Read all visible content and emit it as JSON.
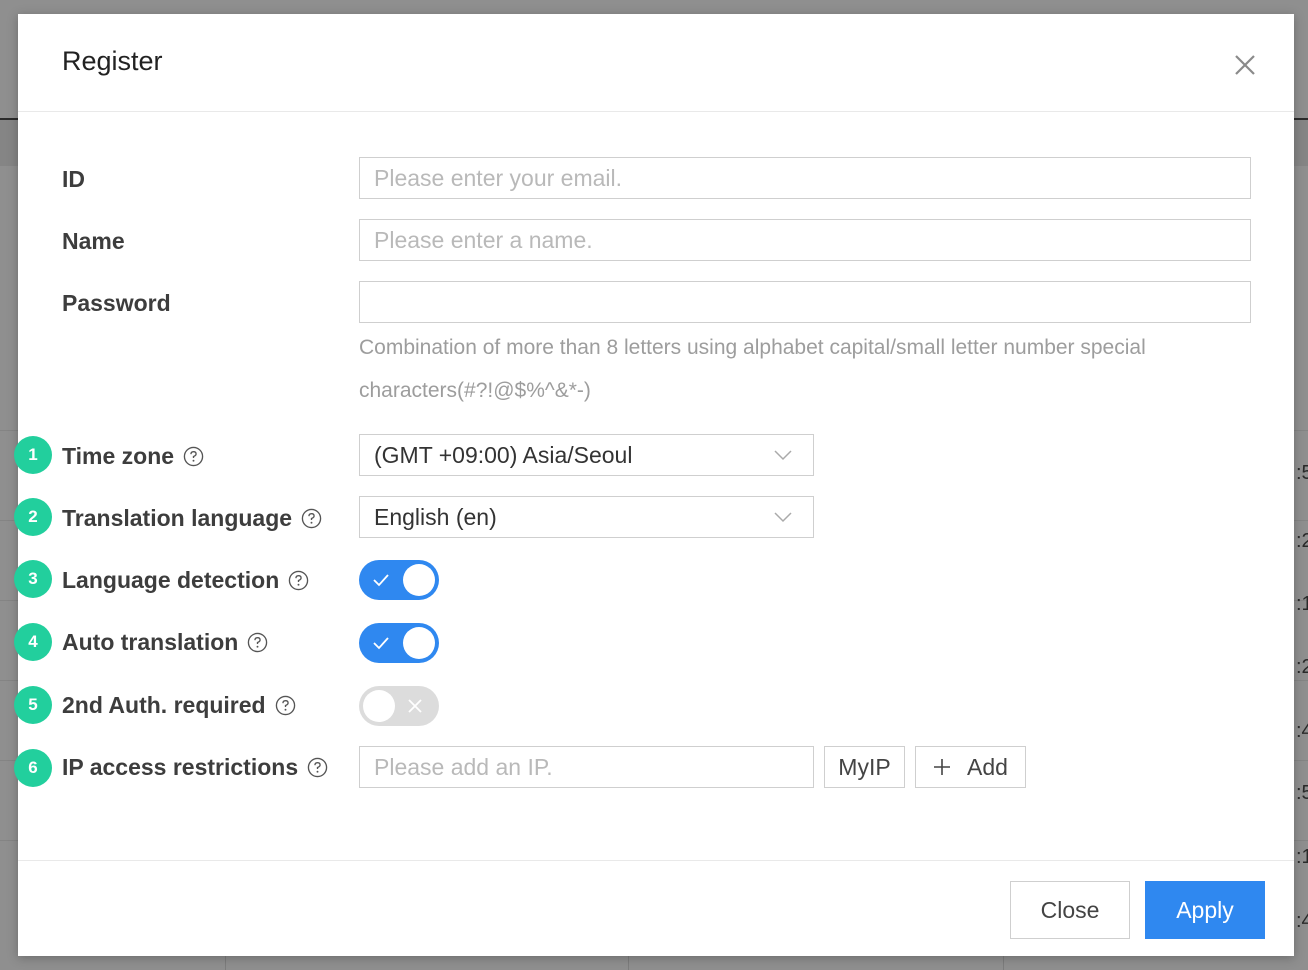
{
  "dialog": {
    "title": "Register",
    "close_icon": "close-icon"
  },
  "form": {
    "id": {
      "label": "ID",
      "placeholder": "Please enter your email.",
      "value": ""
    },
    "name": {
      "label": "Name",
      "placeholder": "Please enter a name.",
      "value": ""
    },
    "password": {
      "label": "Password",
      "value": "",
      "hint_line1": "Combination of more than 8 letters using alphabet capital/small letter number special",
      "hint_line2": "characters(#?!@$%^&*-)"
    },
    "time_zone": {
      "badge": "1",
      "label": "Time zone",
      "selected": "(GMT +09:00) Asia/Seoul"
    },
    "translation_language": {
      "badge": "2",
      "label": "Translation language",
      "selected": "English (en)"
    },
    "language_detection": {
      "badge": "3",
      "label": "Language detection",
      "enabled": true
    },
    "auto_translation": {
      "badge": "4",
      "label": "Auto translation",
      "enabled": true
    },
    "second_auth": {
      "badge": "5",
      "label": "2nd Auth. required",
      "enabled": false
    },
    "ip_restrictions": {
      "badge": "6",
      "label": "IP access restrictions",
      "placeholder": "Please add an IP.",
      "myip_label": "MyIP",
      "add_label": "Add"
    }
  },
  "footer": {
    "close_label": "Close",
    "apply_label": "Apply"
  },
  "colors": {
    "accent": "#2f88f0",
    "badge": "#22cf9d",
    "toggle_off": "#dcdcdc"
  },
  "background_fragments": [
    ":5",
    ":2",
    ":1",
    ":2",
    ":4",
    ":5",
    ":1",
    ":4"
  ]
}
